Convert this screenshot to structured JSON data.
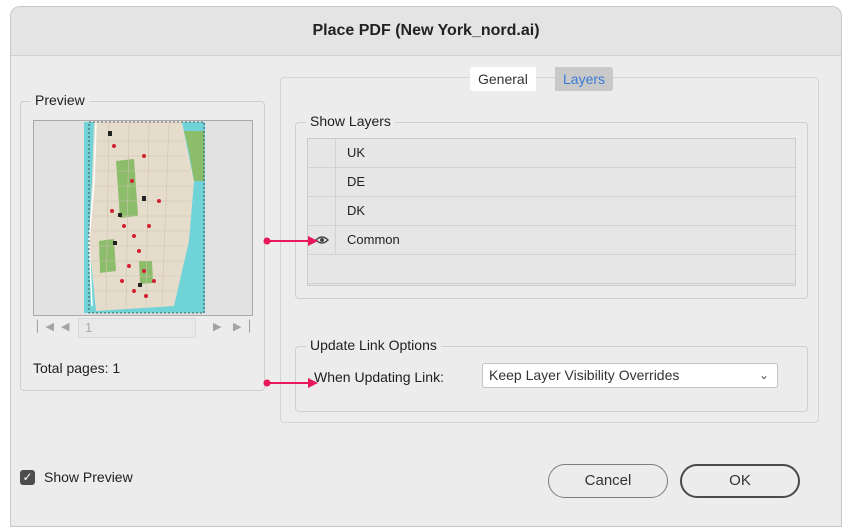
{
  "window": {
    "title": "Place PDF (New York_nord.ai)"
  },
  "preview": {
    "legend": "Preview",
    "page_field_value": "1",
    "total_pages": "Total pages: 1",
    "nav_icons": [
      "first-page-icon",
      "previous-page-icon",
      "next-page-icon",
      "last-page-icon"
    ]
  },
  "tabs": [
    {
      "label": "General",
      "selected": false
    },
    {
      "label": "Layers",
      "selected": true
    }
  ],
  "show_layers": {
    "legend": "Show Layers",
    "layers": [
      {
        "name": "UK",
        "visible": false
      },
      {
        "name": "DE",
        "visible": false
      },
      {
        "name": "DK",
        "visible": false
      },
      {
        "name": "Common",
        "visible": true
      }
    ]
  },
  "update_link": {
    "legend": "Update Link Options",
    "label": "When Updating Link:",
    "selected_option": "Keep Layer Visibility Overrides"
  },
  "footer": {
    "show_preview_label": "Show Preview",
    "show_preview_checked": true,
    "cancel_label": "Cancel",
    "ok_label": "OK"
  },
  "colors": {
    "annotation_arrow": "#e8195a",
    "selected_tab_text": "#3a7bd5",
    "map_water": "#6fd3d8",
    "map_land": "#e6dccb",
    "map_park": "#8bbd6a"
  }
}
